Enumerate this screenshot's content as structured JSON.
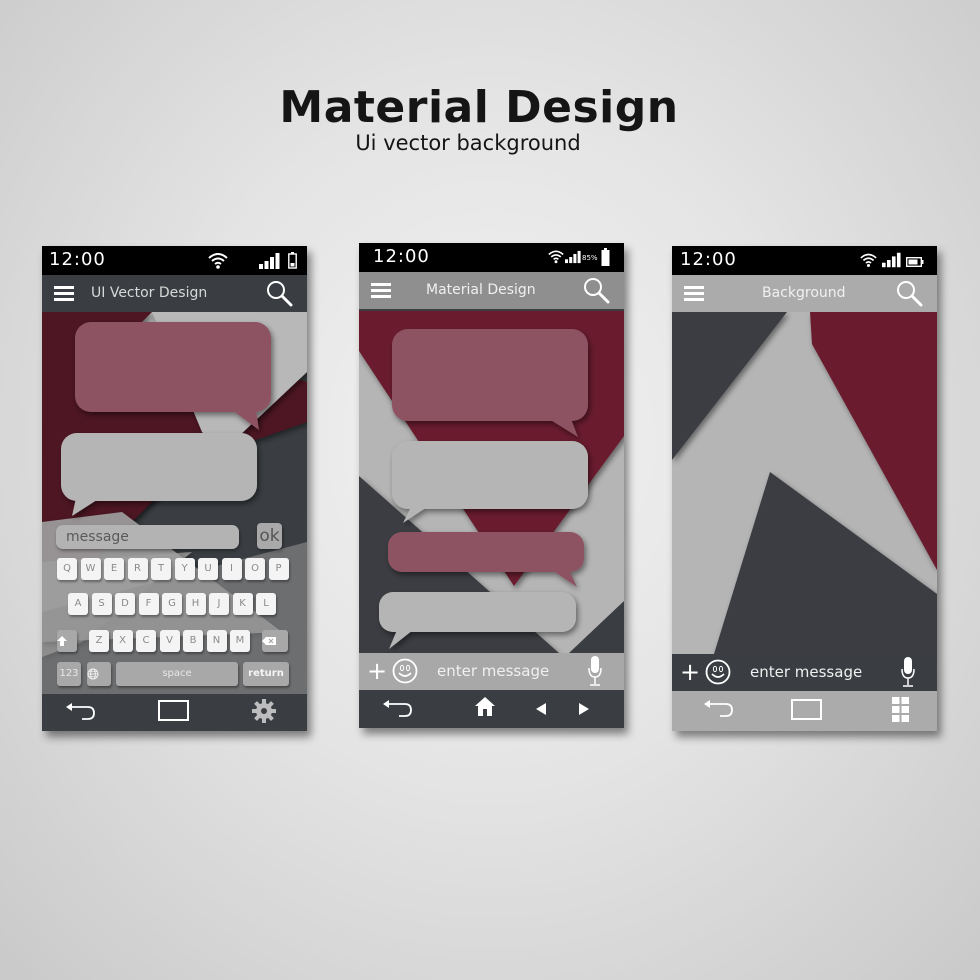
{
  "header": {
    "title": "Material Design",
    "subtitle": "Ui vector background"
  },
  "colors": {
    "crimson": "#6b1a2e",
    "bubble_rose": "#8e5262",
    "light_gray": "#b5b5b5",
    "charcoal": "#3a3e42",
    "black": "#000000"
  },
  "phones": [
    {
      "status": {
        "time": "12:00",
        "icons": [
          "wifi-icon",
          "signal-icon",
          "battery-icon"
        ]
      },
      "appbar": {
        "title": "UI Vector Design",
        "icons": [
          "menu-icon",
          "search-icon"
        ]
      },
      "compose": {
        "placeholder": "message",
        "ok_label": "ok"
      },
      "keyboard": {
        "row1": [
          "Q",
          "W",
          "E",
          "R",
          "T",
          "Y",
          "U",
          "I",
          "O",
          "P"
        ],
        "row2": [
          "A",
          "S",
          "D",
          "F",
          "G",
          "H",
          "J",
          "K",
          "L"
        ],
        "row3": [
          "Z",
          "X",
          "C",
          "V",
          "B",
          "N",
          "M"
        ],
        "shift_icon": "shift-icon",
        "backspace_icon": "backspace-icon",
        "numbers_label": "123",
        "globe_icon": "globe-icon",
        "space_label": "space",
        "return_label": "return"
      },
      "navbar": {
        "icons": [
          "back-icon",
          "home-rectangle-icon",
          "settings-gear-icon"
        ]
      }
    },
    {
      "status": {
        "time": "12:00",
        "battery_percent": "85%",
        "icons": [
          "wifi-icon",
          "signal-icon",
          "battery-icon"
        ]
      },
      "appbar": {
        "title": "Material Design",
        "icons": [
          "menu-icon",
          "search-icon"
        ]
      },
      "inputbar": {
        "placeholder": "enter message",
        "icons": [
          "plus-icon",
          "smiley-icon",
          "microphone-icon"
        ]
      },
      "navbar": {
        "icons": [
          "back-icon",
          "home-icon",
          "previous-icon",
          "next-icon"
        ]
      }
    },
    {
      "status": {
        "time": "12:00",
        "icons": [
          "wifi-icon",
          "signal-icon",
          "battery-icon"
        ]
      },
      "appbar": {
        "title": "Background",
        "icons": [
          "menu-icon",
          "search-icon"
        ]
      },
      "inputbar": {
        "placeholder": "enter message",
        "icons": [
          "plus-icon",
          "smiley-icon",
          "microphone-icon"
        ]
      },
      "navbar": {
        "icons": [
          "back-icon",
          "home-rectangle-icon",
          "apps-grid-icon"
        ]
      }
    }
  ]
}
